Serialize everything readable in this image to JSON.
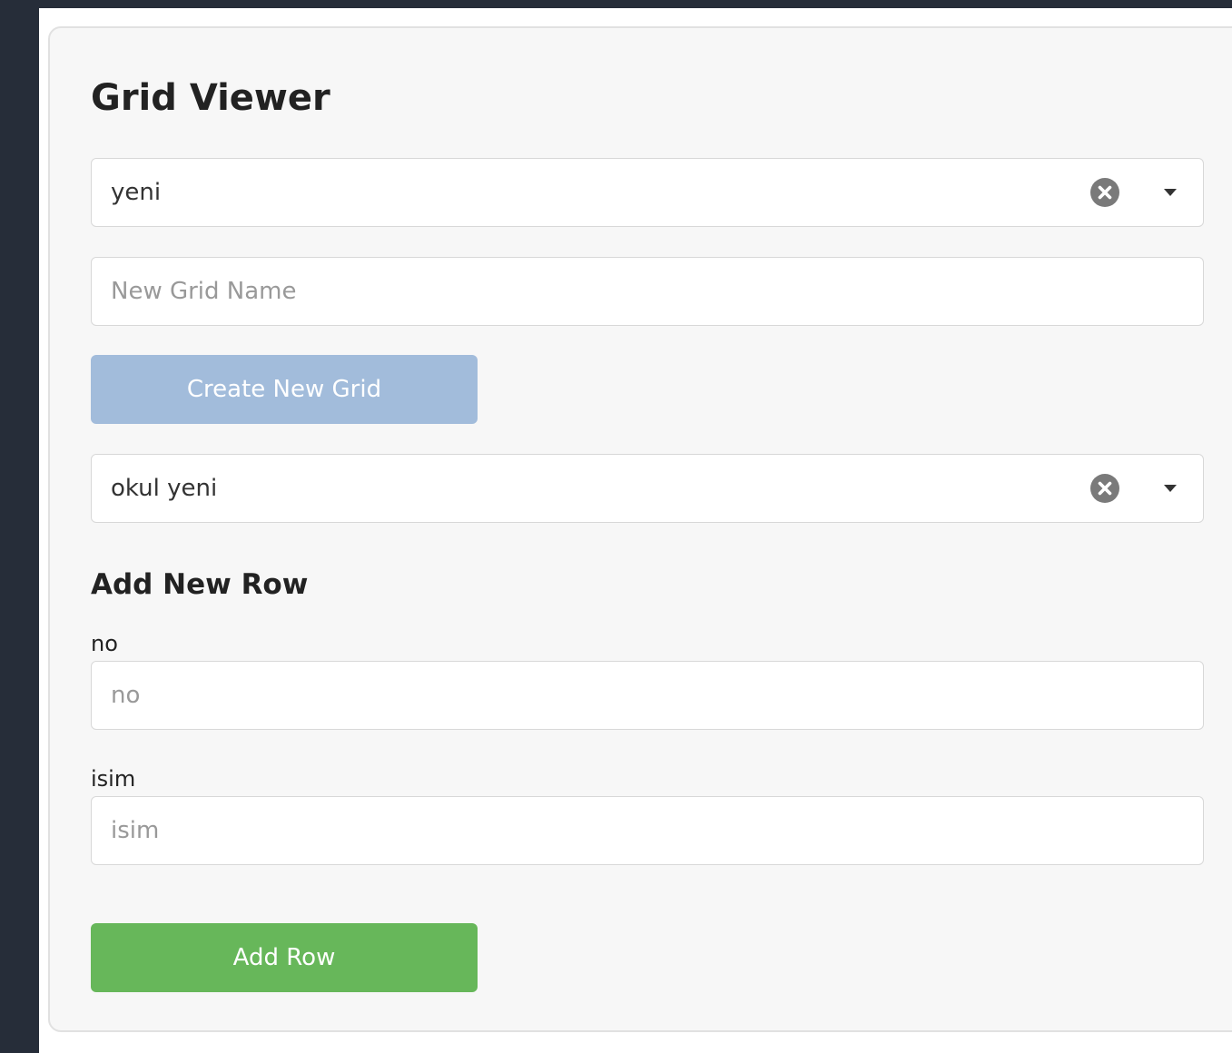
{
  "page": {
    "title": "Grid Viewer"
  },
  "grid_select": {
    "value": "yeni"
  },
  "new_grid": {
    "placeholder": "New Grid Name",
    "create_label": "Create New Grid"
  },
  "row_grid_select": {
    "value": "okul yeni"
  },
  "add_row": {
    "title": "Add New Row",
    "fields": [
      {
        "label": "no",
        "placeholder": "no"
      },
      {
        "label": "isim",
        "placeholder": "isim"
      }
    ],
    "button_label": "Add Row"
  },
  "colors": {
    "sidebar": "#262d39",
    "card_background": "#f7f7f7",
    "create_button": "#a2bcdb",
    "add_button": "#67b75a"
  },
  "icons": [
    "clear-icon",
    "caret-down-icon"
  ]
}
